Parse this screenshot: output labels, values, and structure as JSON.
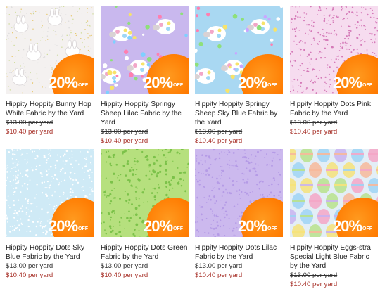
{
  "badge": {
    "percent": "20%",
    "off": "OFF",
    "color": "#ff7a00"
  },
  "products": [
    {
      "title": "Hippity Hoppity Bunny Hop White Fabric by the Yard",
      "old_price": "$13.00 per yard",
      "new_price": "$10.40 per yard",
      "pattern": "bunny-white",
      "bg": "#f4f1f0"
    },
    {
      "title": "Hippity Hoppity Springy Sheep Lilac Fabric by the Yard",
      "old_price": "$13.00 per yard",
      "new_price": "$10.40 per yard",
      "pattern": "sheep-lilac",
      "bg": "#c9b8ee"
    },
    {
      "title": "Hippity Hoppity Springy Sheep Sky Blue Fabric by the Yard",
      "old_price": "$13.00 per yard",
      "new_price": "$10.40 per yard",
      "pattern": "sheep-blue",
      "bg": "#a9d8f2"
    },
    {
      "title": "Hippity Hoppity Dots Pink Fabric by the Yard",
      "old_price": "$13.00 per yard",
      "new_price": "$10.40 per yard",
      "pattern": "dots-pink",
      "bg": "#f6dcef"
    },
    {
      "title": "Hippity Hoppity Dots Sky Blue Fabric by the Yard",
      "old_price": "$13.00 per yard",
      "new_price": "$10.40 per yard",
      "pattern": "dots-sky",
      "bg": "#cfeaf6"
    },
    {
      "title": "Hippity Hoppity Dots Green Fabric by the Yard",
      "old_price": "$13.00 per yard",
      "new_price": "$10.40 per yard",
      "pattern": "dots-green",
      "bg": "#b6e07e"
    },
    {
      "title": "Hippity Hoppity Dots Lilac Fabric by the Yard",
      "old_price": "$13.00 per yard",
      "new_price": "$10.40 per yard",
      "pattern": "dots-lilac",
      "bg": "#ccb9ee"
    },
    {
      "title": "Hippity Hoppity Eggs-stra Special Light Blue Fabric by the Yard",
      "old_price": "$13.00 per yard",
      "new_price": "$10.40 per yard",
      "pattern": "eggs",
      "bg": "#e3eef6"
    }
  ]
}
